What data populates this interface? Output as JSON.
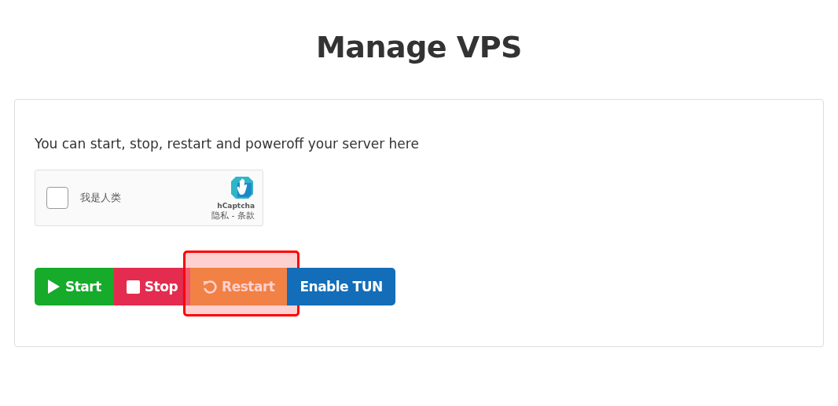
{
  "title": "Manage VPS",
  "card": {
    "description": "You can start, stop, restart and poweroff your server here",
    "captcha": {
      "checked": false,
      "label": "我是人类",
      "brand": "hCaptcha",
      "links": "隐私 - 条款"
    },
    "buttons": [
      {
        "kind": "start",
        "label": "Start",
        "highlighted": false
      },
      {
        "kind": "stop",
        "label": "Stop",
        "highlighted": false
      },
      {
        "kind": "restart",
        "label": "Restart",
        "highlighted": true
      },
      {
        "kind": "tun",
        "label": "Enable TUN",
        "highlighted": false
      }
    ]
  }
}
